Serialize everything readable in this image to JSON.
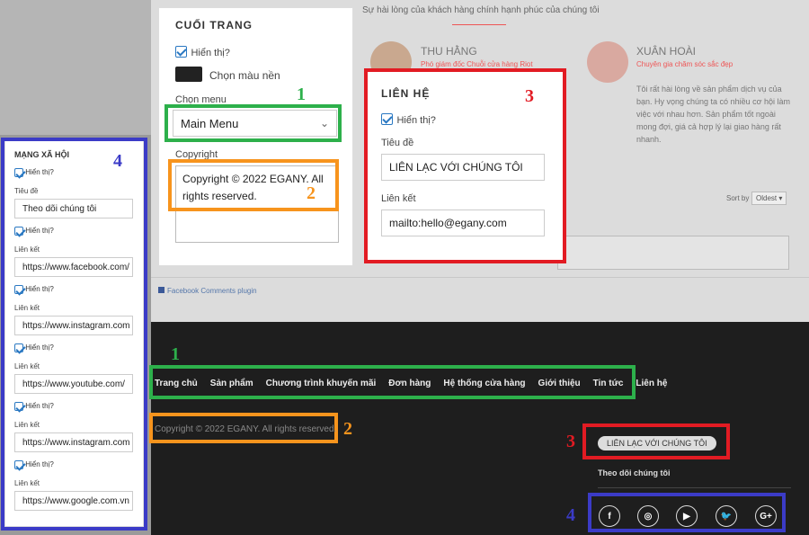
{
  "site": {
    "testimonial_heading": "Sự hài lòng của khách hàng chính hạnh phúc của chúng tôi",
    "person1_name": "THU HẰNG",
    "person1_role": "Phó giám đốc Chuỗi cửa hàng Riot",
    "person2_name": "XUÂN HOÀI",
    "person2_role": "Chuyên gia chăm sóc sắc đẹp",
    "person2_quote": "Tôi rất hài lòng về sản phẩm dịch vụ của bạn. Hy vọng chúng ta có nhiều cơ hội làm việc với nhau hơn. Sản phẩm tốt ngoài mong đợi, giá cả hợp lý lại giao hàng rất nhanh.",
    "sort_label": "Sort by",
    "sort_value": "Oldest ▾",
    "fb_plugin": "Facebook Comments plugin"
  },
  "footer_panel": {
    "title": "CUỐI TRANG",
    "show_label": "Hiển thị?",
    "bg_color_label": "Chọn màu nền",
    "bg_color": "#222222",
    "menu_label": "Chọn menu",
    "menu_value": "Main Menu",
    "copyright_label": "Copyright",
    "copyright_value": "Copyright © 2022 EGANY. All rights reserved."
  },
  "contact_panel": {
    "title": "LIÊN HỆ",
    "show_label": "Hiển thị?",
    "title_label": "Tiêu đề",
    "title_value": "LIÊN LẠC VỚI CHÚNG TÔI",
    "link_label": "Liên kết",
    "link_value": "mailto:hello@egany.com"
  },
  "social_panel": {
    "title": "MẠNG XÃ HỘI",
    "show_label": "Hiển thị?",
    "title_label": "Tiêu đề",
    "title_value": "Theo dõi chúng tôi",
    "link_label": "Liên kết",
    "links": [
      "https://www.facebook.com/",
      "https://www.instagram.com",
      "https://www.youtube.com/",
      "https://www.instagram.com",
      "https://www.google.com.vn"
    ]
  },
  "footer": {
    "nav": [
      "Trang chủ",
      "Sản phẩm",
      "Chương trình khuyến mãi",
      "Đơn hàng",
      "Hệ thống cửa hàng",
      "Giới thiệu",
      "Tin tức",
      "Liên hệ"
    ],
    "copyright": "Copyright © 2022 EGANY. All rights reserved.",
    "contact_button": "LIÊN LẠC VỚI CHÚNG TÔI",
    "follow_label": "Theo dõi chúng tôi",
    "social_icons": [
      "f",
      "◎",
      "▶",
      "🐦",
      "G+"
    ]
  },
  "annotations": {
    "n1": "1",
    "n2": "2",
    "n3": "3",
    "n4": "4",
    "colors": {
      "green": "#2db04b",
      "orange": "#f7941d",
      "red": "#e21b23",
      "blue": "#3b3bc7"
    }
  }
}
